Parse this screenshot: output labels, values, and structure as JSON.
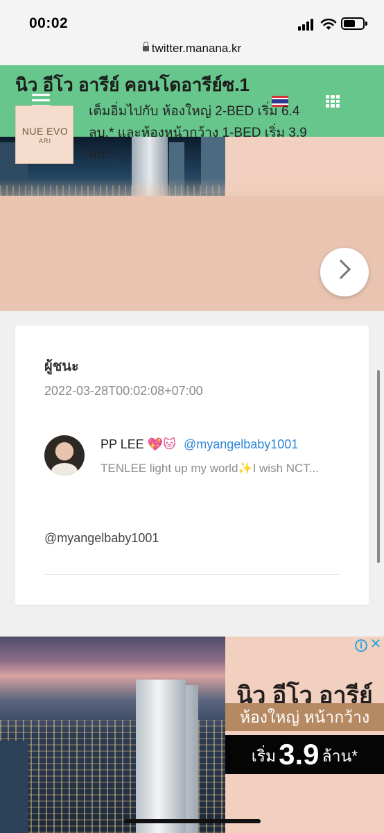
{
  "status_bar": {
    "time": "00:02"
  },
  "browser": {
    "url": "twitter.manana.kr"
  },
  "header": {
    "menu_icon": "hamburger-icon",
    "language_flag": "thai-flag-icon",
    "apps_icon": "grid-icon",
    "color": "#66c68b"
  },
  "banner_ad": {
    "title": "นิว อีโว อารีย์ คอนโดอารีย์ซ.1",
    "logo_main": "NUE EVO",
    "logo_sub": "ARI",
    "description": "เต็มอิ่มไปกับ ห้องใหญ่ 2-BED เริ่ม 6.4 ลบ.* และห้องหน้ากว้าง 1-BED เริ่ม 3.9 ลบ.*",
    "next_icon": "chevron-right-icon"
  },
  "post": {
    "title": "ผู้ชนะ",
    "timestamp": "2022-03-28T00:02:08+07:00",
    "tweet": {
      "author_name": "PP LEE",
      "author_emoji": "💖🐱",
      "handle": "@myangelbaby1001",
      "text": "TENLEE light up my world✨I wish NCT..."
    },
    "mention": "@myangelbaby1001"
  },
  "bottom_ad": {
    "info_icon": "info-icon",
    "close_icon": "close-icon",
    "title": "นิว อีโว อารีย์",
    "tagline": "ห้องใหญ่ หน้ากว้าง",
    "price_prefix": "เริ่ม",
    "price_value": "3.9",
    "price_suffix": "ล้าน*"
  },
  "colors": {
    "header_green": "#66c68b",
    "link_blue": "#2f86d8",
    "ad_peach": "#f2d0bf"
  }
}
